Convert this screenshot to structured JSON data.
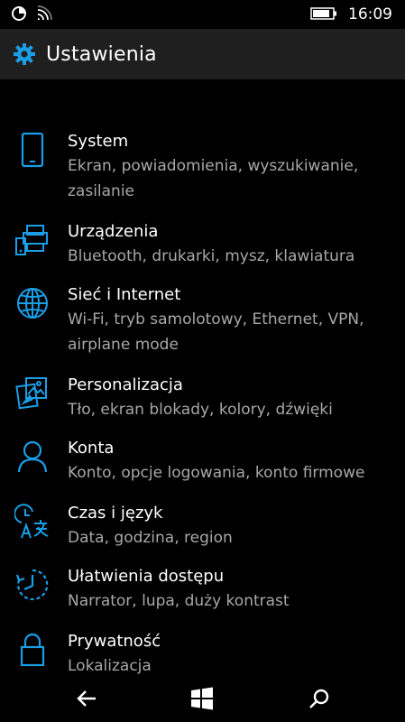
{
  "status": {
    "time": "16:09"
  },
  "header": {
    "title": "Ustawienia"
  },
  "items": [
    {
      "title": "System",
      "subtitle": "Ekran, powiadomienia, wyszukiwanie, zasilanie",
      "icon": "phone-icon"
    },
    {
      "title": "Urządzenia",
      "subtitle": "Bluetooth, drukarki, mysz, klawiatura",
      "icon": "devices-icon"
    },
    {
      "title": "Sieć i Internet",
      "subtitle": "Wi-Fi, tryb samolotowy, Ethernet, VPN, airplane mode",
      "icon": "globe-icon"
    },
    {
      "title": "Personalizacja",
      "subtitle": "Tło, ekran blokady, kolory, dźwięki",
      "icon": "personalization-icon"
    },
    {
      "title": "Konta",
      "subtitle": "Konto, opcje logowania, konto firmowe",
      "icon": "person-icon"
    },
    {
      "title": "Czas i język",
      "subtitle": "Data, godzina, region",
      "icon": "time-language-icon"
    },
    {
      "title": "Ułatwienia dostępu",
      "subtitle": "Narrator, lupa, duży kontrast",
      "icon": "ease-of-access-icon"
    },
    {
      "title": "Prywatność",
      "subtitle": "Lokalizacja",
      "icon": "lock-icon"
    }
  ],
  "colors": {
    "accent": "#1a9ee6",
    "background": "#000000",
    "header": "#1f1f1f",
    "subtitle": "#a8a8a8"
  }
}
